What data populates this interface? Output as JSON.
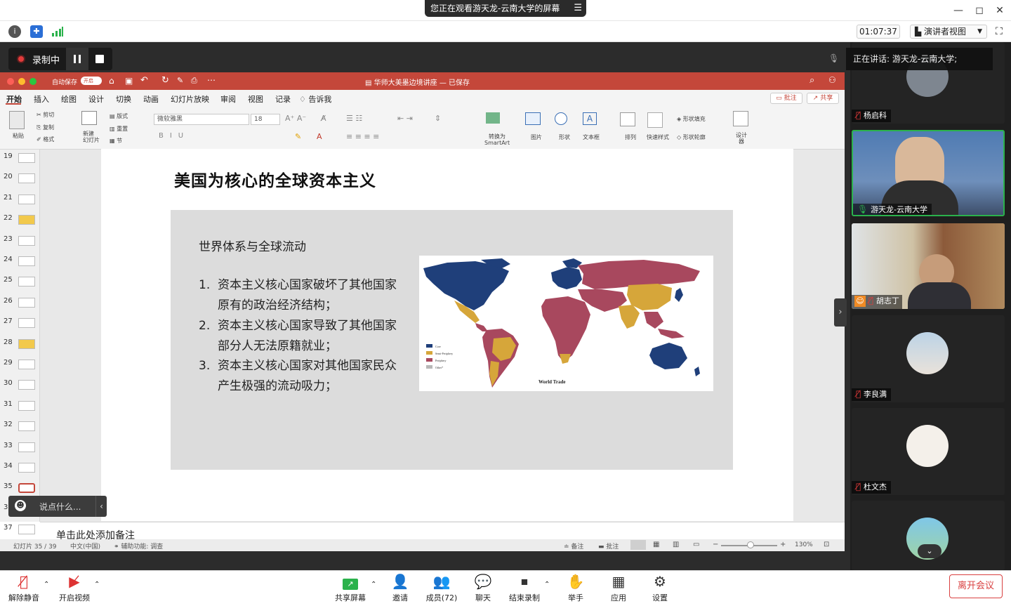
{
  "window": {
    "share_banner": "您正在观看游天龙-云南大学的屏幕",
    "minimize": "—",
    "restore": "◻",
    "close": "✕"
  },
  "zoom_toolbar": {
    "timer": "01:07:37",
    "view_button": "演讲者视图"
  },
  "recording": {
    "label": "录制中"
  },
  "ppt": {
    "autosave": "自动保存",
    "autosave_state": "开启",
    "doc_title": "华师大美墨边境讲座 — 已保存",
    "tabs": [
      "开始",
      "插入",
      "绘图",
      "设计",
      "切换",
      "动画",
      "幻灯片放映",
      "审阅",
      "视图",
      "记录",
      "告诉我"
    ],
    "comments_btn": "批注",
    "share_btn": "共享",
    "ribbon": {
      "paste": "粘贴",
      "cut": "剪切",
      "copy": "复制",
      "format": "格式",
      "new_slide": "新建\n幻灯片",
      "layout": "版式",
      "reset": "重置",
      "section": "节",
      "font_name": "微软雅黑",
      "font_size": "18",
      "smartart": "转换为\nSmartArt",
      "picture": "图片",
      "shape": "形状",
      "textbox": "文本框",
      "arrange": "排列",
      "quick_styles": "快速样式",
      "shape_fill": "形状填充",
      "shape_outline": "形状轮廓",
      "designer": "设计\n器"
    },
    "thumbnails": [
      "19",
      "20",
      "21",
      "22",
      "23",
      "24",
      "25",
      "26",
      "27",
      "28",
      "29",
      "30",
      "31",
      "32",
      "33",
      "34",
      "35",
      "36",
      "37"
    ],
    "notes_placeholder": "单击此处添加备注",
    "status": {
      "slide_counter": "幻灯片 35 / 39",
      "language": "中文(中国)",
      "accessibility": "辅助功能: 调查",
      "notes": "备注",
      "comments": "批注",
      "zoom": "130%"
    }
  },
  "slide": {
    "title": "美国为核心的全球资本主义",
    "subtitle": "世界体系与全球流动",
    "items": [
      {
        "num": "1.",
        "text": "资本主义核心国家破坏了其他国家原有的政治经济结构；"
      },
      {
        "num": "2.",
        "text": "资本主义核心国家导致了其他国家部分人无法原籍就业；"
      },
      {
        "num": "3.",
        "text": "资本主义核心国家对其他国家民众产生极强的流动吸力；"
      }
    ],
    "map": {
      "caption": "World Trade",
      "legend": [
        "Core",
        "Semi-Periphery",
        "Periphery",
        "Other*"
      ],
      "colors": {
        "core": "#1f3f7a",
        "semi": "#d6a63a",
        "periphery": "#a8485e",
        "other": "#b8b8b8"
      }
    }
  },
  "participants": {
    "speaking_now": "正在讲话: 游天龙-云南大学;",
    "tiles": [
      {
        "name": "杨启科"
      },
      {
        "name": "游天龙-云南大学"
      },
      {
        "name": "胡志丁"
      },
      {
        "name": "李良满"
      },
      {
        "name": "杜文杰"
      }
    ]
  },
  "chat_float": {
    "placeholder": "说点什么..."
  },
  "bottom_toolbar": {
    "unmute": "解除静音",
    "start_video": "开启视频",
    "share_screen": "共享屏幕",
    "invite": "邀请",
    "members": "成员(72)",
    "chat": "聊天",
    "end_recording": "结束录制",
    "raise_hand": "举手",
    "apps": "应用",
    "settings": "设置",
    "leave": "离开会议"
  }
}
